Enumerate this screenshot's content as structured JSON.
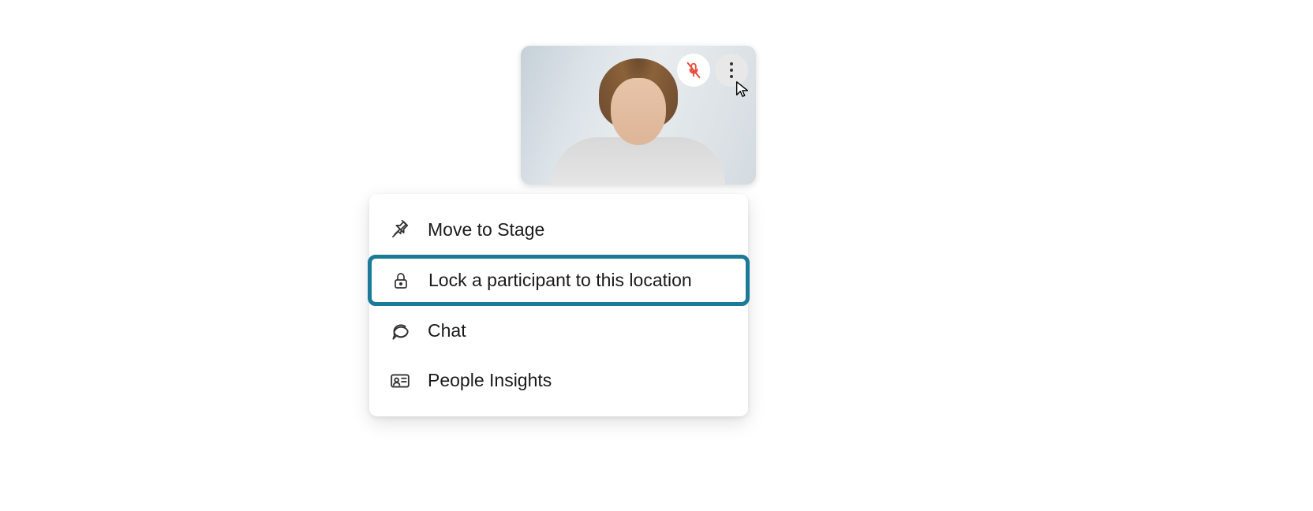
{
  "participant": {
    "muted": true,
    "avatar_alt": "participant video"
  },
  "controls": {
    "mic_icon": "mic-muted-icon",
    "more_icon": "more-options-icon"
  },
  "menu": {
    "items": [
      {
        "icon": "pin-icon",
        "label": "Move to Stage",
        "highlighted": false
      },
      {
        "icon": "lock-icon",
        "label": "Lock a participant to this location",
        "highlighted": true
      },
      {
        "icon": "chat-icon",
        "label": "Chat",
        "highlighted": false
      },
      {
        "icon": "people-insights-icon",
        "label": "People Insights",
        "highlighted": false
      }
    ]
  }
}
